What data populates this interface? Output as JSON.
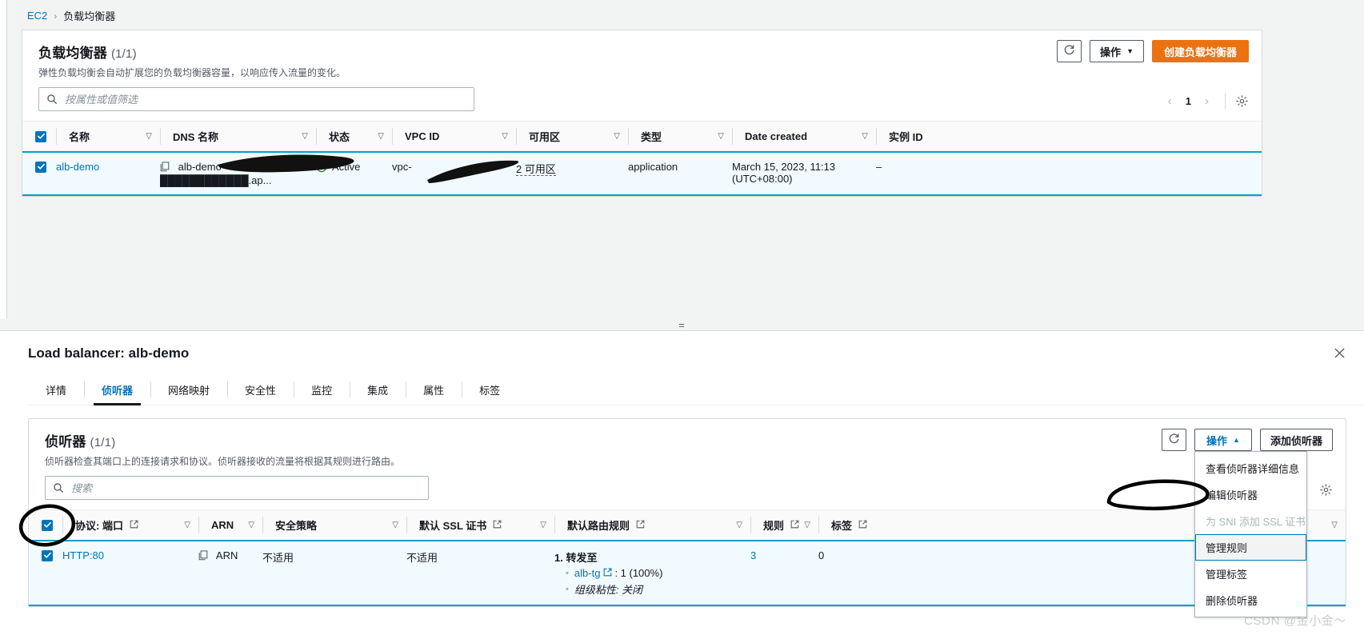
{
  "breadcrumb": {
    "root": "EC2",
    "separator": "›",
    "current": "负载均衡器"
  },
  "lb_panel": {
    "title": "负载均衡器",
    "count": "(1/1)",
    "subtitle": "弹性负载均衡会自动扩展您的负载均衡器容量，以响应传入流量的变化。",
    "refresh_icon": "refresh-icon",
    "actions_label": "操作",
    "create_label": "创建负载均衡器",
    "search_placeholder": "按属性或值筛选",
    "search_value": "",
    "pagination": {
      "prev": "‹",
      "page": "1",
      "next": "›",
      "settings_icon": "gear-icon"
    },
    "columns": [
      "名称",
      "DNS 名称",
      "状态",
      "VPC ID",
      "可用区",
      "类型",
      "Date created",
      "实例 ID"
    ],
    "rows": [
      {
        "selected": true,
        "name": "alb-demo",
        "dns_name": "alb-demo-████████████.ap...",
        "status": "Active",
        "vpc_id_line1": "vpc-",
        "vpc_id_line2": "0███████████",
        "az": "2 可用区",
        "type": "application",
        "date_created_line1": "March 15, 2023, 11:13",
        "date_created_line2": "(UTC+08:00)",
        "instance_id": "–"
      }
    ]
  },
  "splitter": {
    "handle": "="
  },
  "detail": {
    "title": "Load balancer: alb-demo",
    "close_icon": "close-icon",
    "tabs": [
      {
        "label": "详情",
        "active": false
      },
      {
        "label": "侦听器",
        "active": true
      },
      {
        "label": "网络映射",
        "active": false
      },
      {
        "label": "安全性",
        "active": false
      },
      {
        "label": "监控",
        "active": false
      },
      {
        "label": "集成",
        "active": false
      },
      {
        "label": "属性",
        "active": false
      },
      {
        "label": "标签",
        "active": false
      }
    ]
  },
  "listeners_panel": {
    "title": "侦听器",
    "count": "(1/1)",
    "subtitle": "侦听器检查其端口上的连接请求和协议。侦听器接收的流量将根据其规则进行路由。",
    "refresh_icon": "refresh-icon",
    "actions_label": "操作",
    "add_listener_label": "添加侦听器",
    "search_placeholder": "搜索",
    "search_value": "",
    "settings_icon": "gear-icon",
    "actions_menu": [
      {
        "label": "查看侦听器详细信息",
        "disabled": false,
        "highlighted": false
      },
      {
        "label": "编辑侦听器",
        "disabled": false,
        "highlighted": false
      },
      {
        "label": "为 SNI 添加 SSL 证书",
        "disabled": true,
        "highlighted": false
      },
      {
        "label": "管理规则",
        "disabled": false,
        "highlighted": true
      },
      {
        "label": "管理标签",
        "disabled": false,
        "highlighted": false
      },
      {
        "label": "删除侦听器",
        "disabled": false,
        "highlighted": false
      }
    ],
    "columns": [
      "协议: 端口",
      "ARN",
      "安全策略",
      "默认 SSL 证书",
      "默认路由规则",
      "规则",
      "标签"
    ],
    "rows": [
      {
        "selected": true,
        "protocol_port": "HTTP:80",
        "arn": "ARN",
        "security_policy": "不适用",
        "default_ssl_cert": "不适用",
        "default_rule_heading": "1. 转发至",
        "default_rule_target": "alb-tg",
        "default_rule_target_suffix": ": 1 (100%)",
        "default_rule_stickiness": "组级粘性: 关闭",
        "rules": "3",
        "tags": "0"
      }
    ]
  },
  "watermark": "CSDN @金小金～",
  "colors": {
    "accent_blue": "#0073bb",
    "primary_orange": "#ec7211",
    "status_green": "#1d8102",
    "selected_row_bg": "#f1faff",
    "selection_border": "#00a1c9"
  }
}
